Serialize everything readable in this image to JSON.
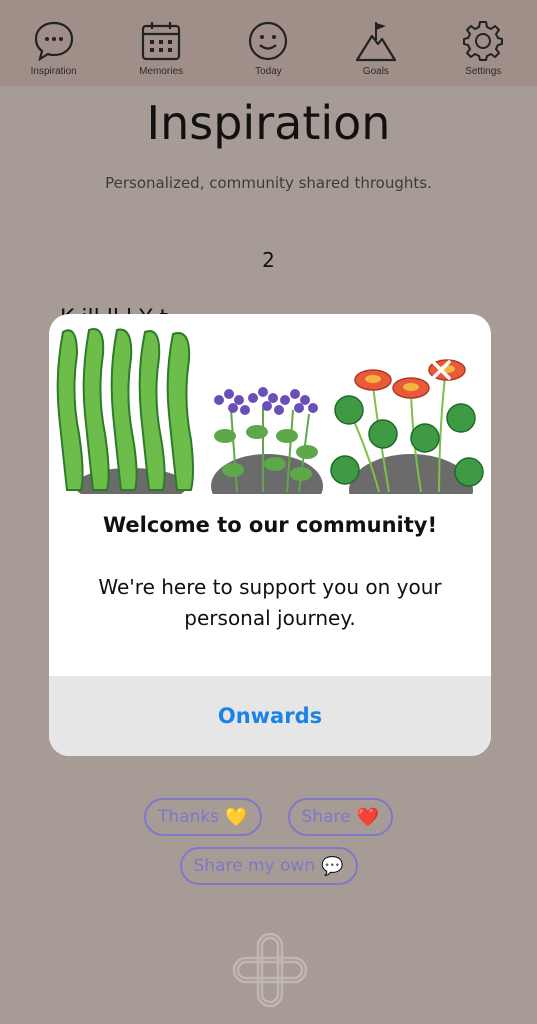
{
  "nav": {
    "items": [
      {
        "label": "Inspiration",
        "icon": "speech-bubble-icon"
      },
      {
        "label": "Memories",
        "icon": "calendar-icon"
      },
      {
        "label": "Today",
        "icon": "smiley-icon"
      },
      {
        "label": "Goals",
        "icon": "mountain-flag-icon"
      },
      {
        "label": "Settings",
        "icon": "gear-icon"
      }
    ]
  },
  "page": {
    "title": "Inspiration",
    "subtitle": "Personalized, community shared throughts.",
    "counter": "2",
    "partial_text": "K ill ll l Y t"
  },
  "actions": {
    "thanks_label": "Thanks",
    "share_label": "Share",
    "share_own_label": "Share my own"
  },
  "modal": {
    "title": "Welcome to our community!",
    "body": "We're here to support you on your personal journey.",
    "button_label": "Onwards"
  },
  "colors": {
    "background": "#a79b96",
    "nav_background": "#a08f88",
    "pill_accent": "#7f77c8",
    "link_blue": "#1a82e8"
  }
}
